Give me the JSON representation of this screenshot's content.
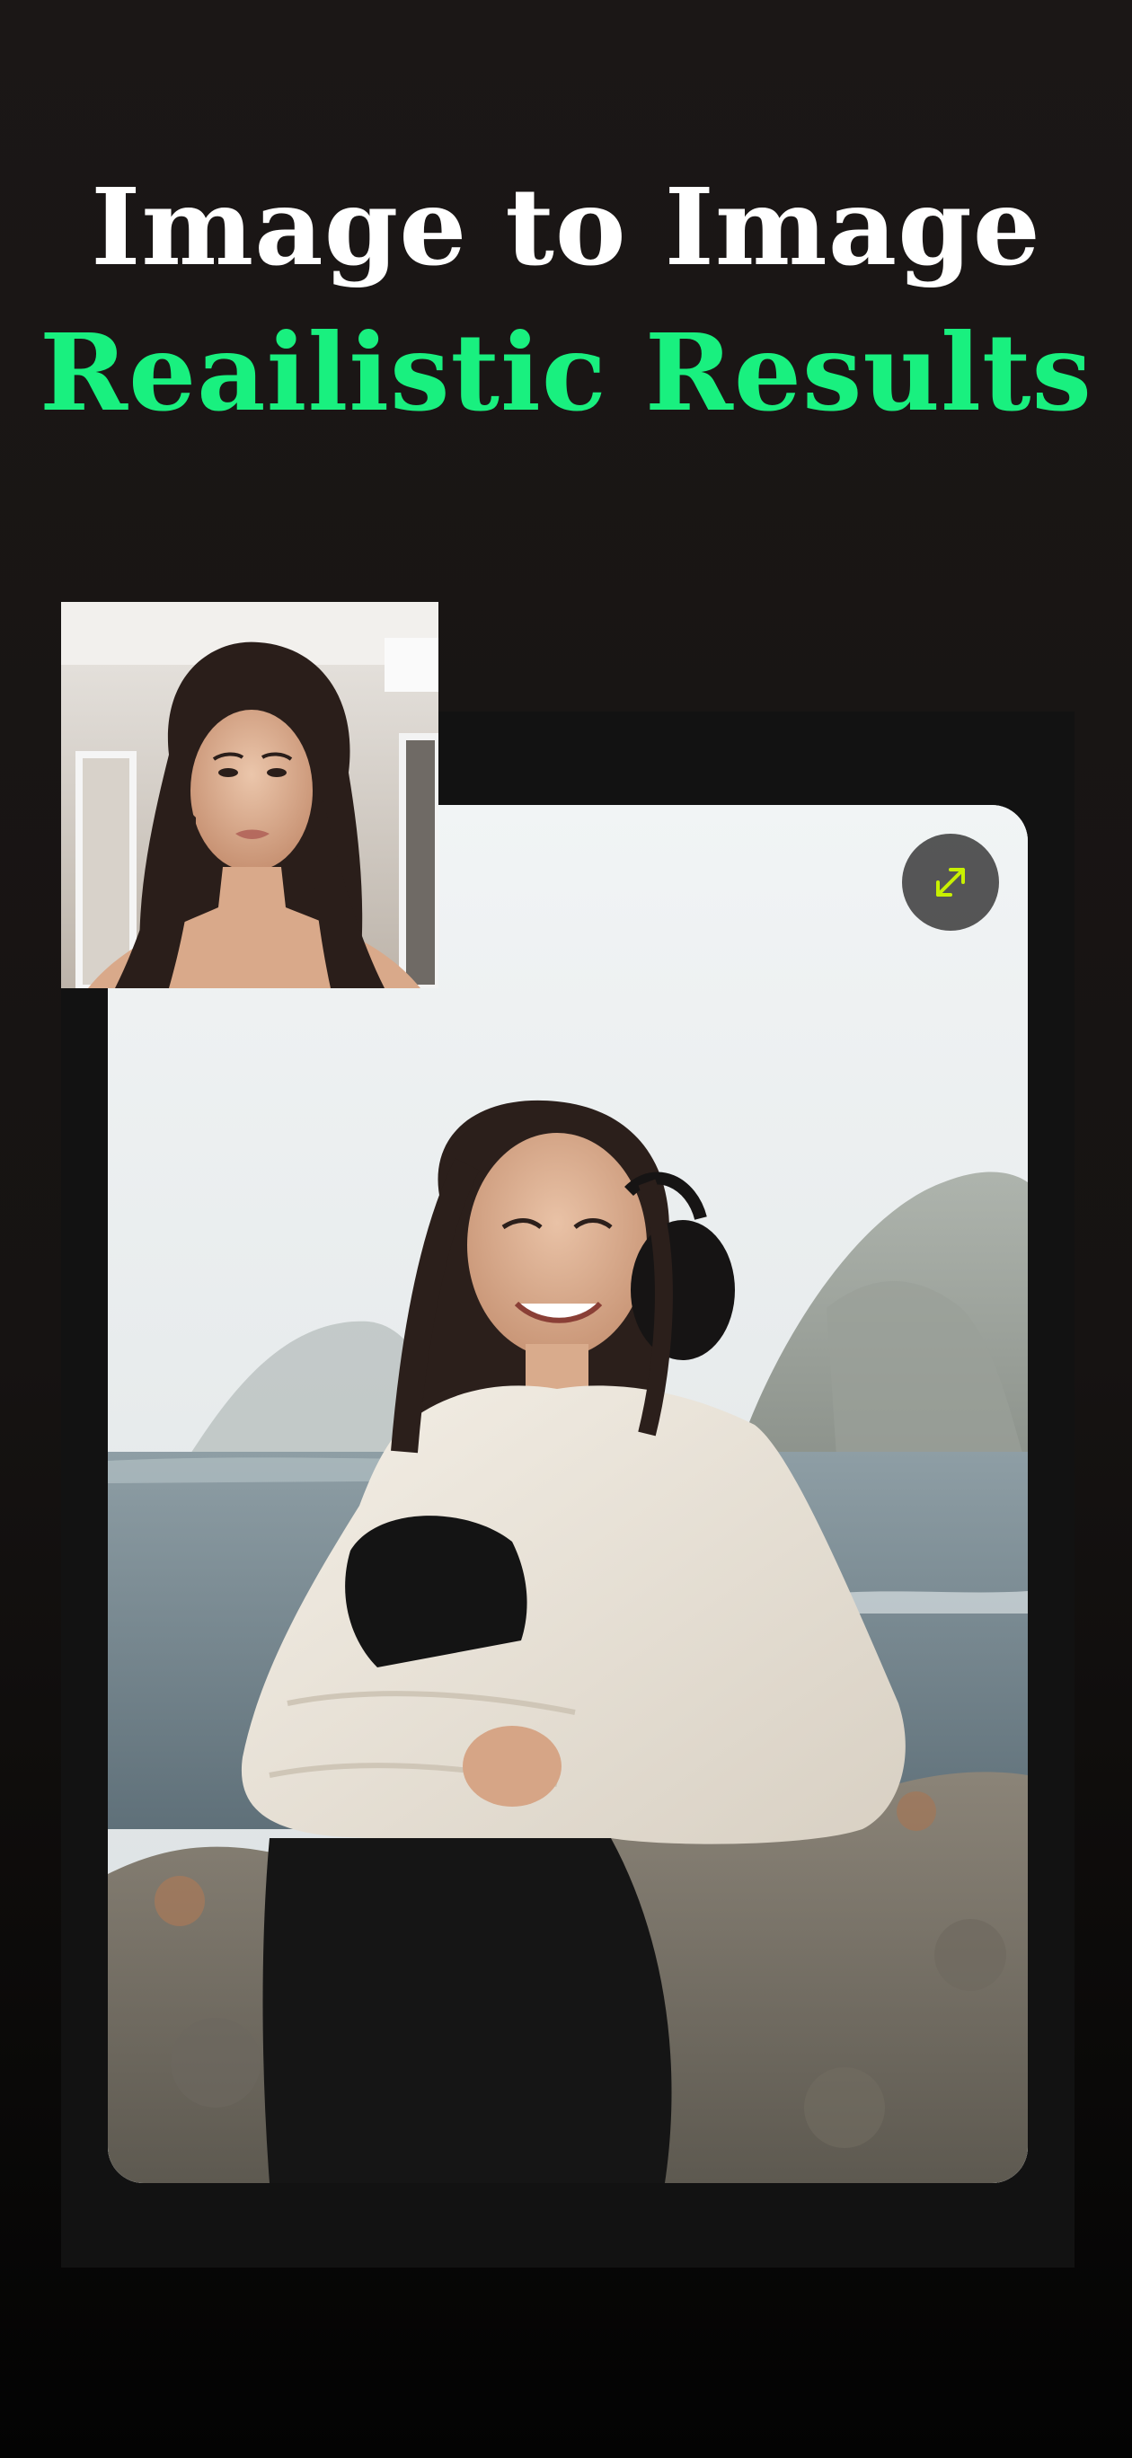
{
  "header": {
    "title_line1": "Image to Image",
    "title_line2": "Reailistic Results"
  },
  "colors": {
    "title_line1": "#ffffff",
    "title_line2": "#19f07f",
    "expand_icon": "#c8f000",
    "background": "#161312"
  },
  "source_image": {
    "description_icon": "portrait-photo"
  },
  "result_image": {
    "description_icon": "result-photo"
  },
  "expand_button": {
    "icon": "expand-arrows-icon"
  }
}
